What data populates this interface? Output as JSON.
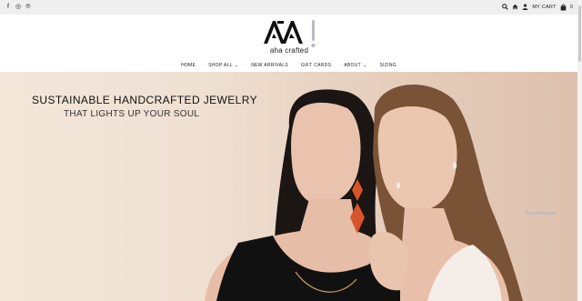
{
  "topbar": {
    "social": [
      {
        "icon": "facebook-icon",
        "glyph": "f"
      },
      {
        "icon": "instagram-icon",
        "glyph": "◎"
      },
      {
        "icon": "pinterest-icon",
        "glyph": "℗"
      }
    ],
    "cart_label": "MY CART",
    "cart_count": "0"
  },
  "brand": {
    "logo_mark": "AA",
    "name": "aha crafted"
  },
  "nav": [
    {
      "label": "HOME",
      "dropdown": false
    },
    {
      "label": "SHOP ALL",
      "dropdown": true
    },
    {
      "label": "NEW ARRIVALS",
      "dropdown": false
    },
    {
      "label": "GIFT CARDS",
      "dropdown": false
    },
    {
      "label": "ABOUT",
      "dropdown": true
    },
    {
      "label": "SIZING",
      "dropdown": false
    }
  ],
  "hero": {
    "headline": "SUSTAINABLE HANDCRAFTED JEWELRY",
    "subline": "THAT LIGHTS UP YOUR SOUL"
  },
  "watermark": "ScanMalware",
  "colors": {
    "topbar_bg": "#efefef",
    "hero_bg": "#efe0d2",
    "earring_orange": "#d9542b"
  }
}
